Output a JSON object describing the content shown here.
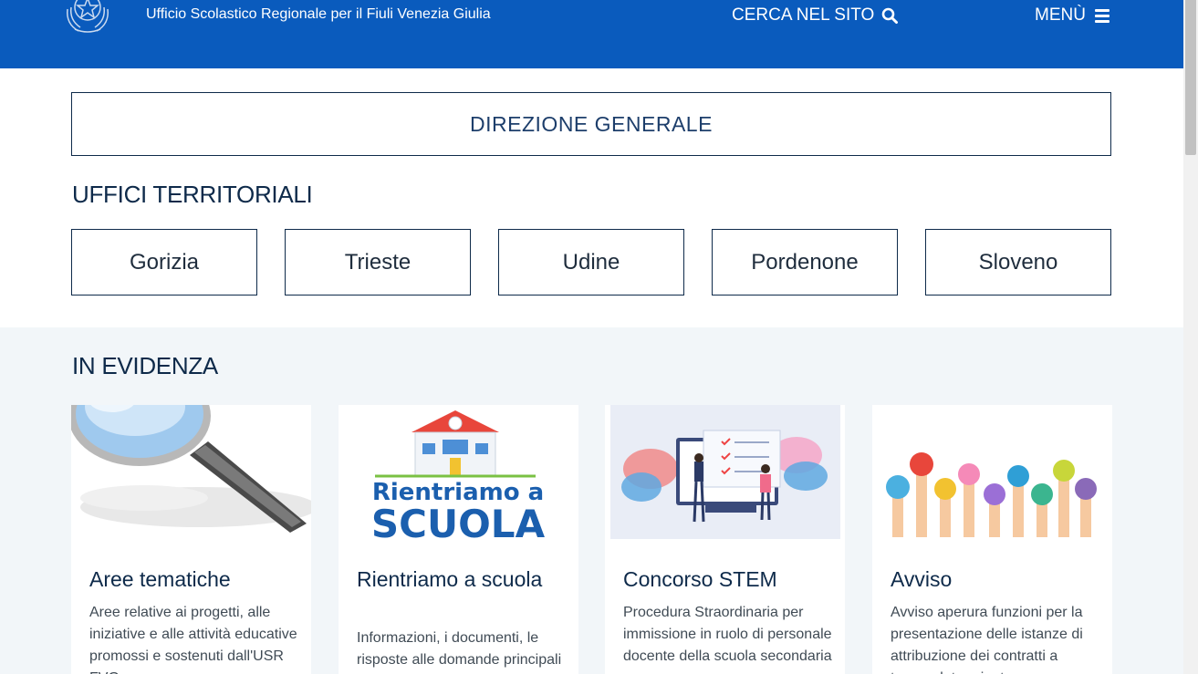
{
  "header": {
    "subtitle": "Ufficio Scolastico Regionale per il Fiuli Venezia Giulia",
    "search_label": "CERCA NEL SITO",
    "menu_label": "MENÙ",
    "search_icon": "search-icon",
    "menu_icon": "hamburger-icon"
  },
  "direzione": {
    "label": "DIREZIONE GENERALE"
  },
  "uffici": {
    "title": "UFFICI TERRITORIALI",
    "offices": [
      "Gorizia",
      "Trieste",
      "Udine",
      "Pordenone",
      "Sloveno"
    ]
  },
  "evidenza": {
    "title": "IN EVIDENZA",
    "cards": [
      {
        "title": "Aree tematiche",
        "text": "Aree relative ai progetti, alle iniziative e alle attività educative promossi e sostenuti dall'USR FVG",
        "image": "magnifying-glass-image"
      },
      {
        "title": "Rientriamo a scuola",
        "text": "Informazioni, i documenti, le risposte alle domande principali",
        "image": "rientriamo-a-scuola-image",
        "image_line1": "Rientriamo a",
        "image_line2": "SCUOLA"
      },
      {
        "title": "Concorso STEM",
        "text": "Procedura Straordinaria per immissione in ruolo di personale docente della scuola secondaria",
        "image": "stem-illustration-image"
      },
      {
        "title": "Avviso",
        "text": "Avviso aperura funzioni per la presentazione delle istanze di attribuzione dei contratti a tempo determinato",
        "image": "painted-hands-image"
      }
    ]
  },
  "colors": {
    "header_bg": "#0a5bbd",
    "section_bg": "#f2f6f9",
    "title_color": "#0e2a4a"
  }
}
